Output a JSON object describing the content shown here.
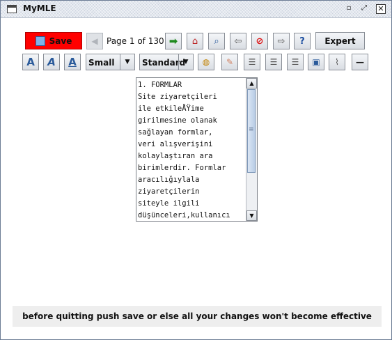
{
  "window": {
    "title": "MyMLE"
  },
  "toolbar": {
    "save_label": "Save",
    "page_indicator": "Page 1 of 130",
    "expert_label": "Expert"
  },
  "format": {
    "size": {
      "selected": "Small"
    },
    "style": {
      "selected": "Standard"
    }
  },
  "editor": {
    "text": "1. FORMLAR\nSite ziyaretçileri\nile etkileÅŸime\ngirilmesine olanak\nsağlayan formlar,\nveri alışverişini\nkolaylaştıran ara\nbirimlerdir. Formlar\naracılığıylala\nziyaretçilerin\nsiteyle ilgili\ndüşünceleri,kullanıcı"
  },
  "status": {
    "message": "before quitting push save or else all your changes won't become effective"
  },
  "icons": {
    "window": "window-icon",
    "save": "save-disk-icon",
    "prev": "arrow-left-icon",
    "next": "arrow-right-icon",
    "home": "home-icon",
    "search": "magnifier-icon",
    "import": "import-icon",
    "stop": "stop-icon",
    "export": "export-icon",
    "help": "help-icon",
    "font_bold": "font-a-icon",
    "font_italic": "font-a-italic-icon",
    "font_underline": "font-a-underline-icon",
    "paint": "palette-icon",
    "eraser": "eraser-icon",
    "align_left": "align-left-icon",
    "align_center": "align-center-icon",
    "align_right": "align-right-icon",
    "image": "image-icon",
    "attach": "paperclip-icon",
    "hr": "horizontal-rule-icon"
  },
  "colors": {
    "save_bg": "#ff0000",
    "status_bg": "#eeeeee"
  }
}
